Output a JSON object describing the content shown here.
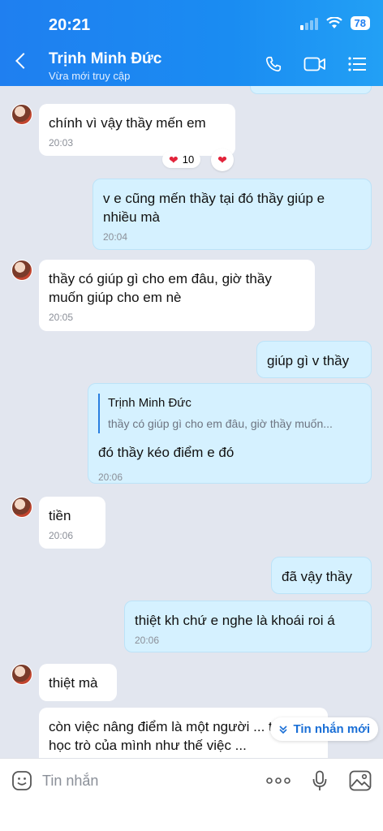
{
  "status_bar": {
    "time": "20:21",
    "battery": "78"
  },
  "header": {
    "contact_name": "Trịnh Minh Đức",
    "contact_status": "Vừa mới truy cập"
  },
  "messages": [
    {
      "text": "chính vì vậy thầy mến em",
      "time": "20:03",
      "reaction_count": "10"
    },
    {
      "text": "v e cũng mến thầy tại đó thầy giúp e nhiều mà",
      "time": "20:04"
    },
    {
      "text": "thầy có giúp gì cho em đâu, giờ thầy muốn giúp cho em nè",
      "time": "20:05"
    },
    {
      "text": "giúp gì v thầy"
    },
    {
      "quote_name": "Trịnh Minh Đức",
      "quote_text": "thầy có giúp gì cho em đâu, giờ thầy muốn...",
      "text": "đó thầy kéo điểm e đó",
      "time": "20:06"
    },
    {
      "text": "tiền",
      "time": "20:06"
    },
    {
      "text": "đã vậy thầy"
    },
    {
      "text": "thiệt kh chứ e nghe là khoái roi á",
      "time": "20:06"
    },
    {
      "text": "thiệt mà"
    },
    {
      "text": "còn việc nâng điểm là một người ... thầy học trò của mình như thế việc ..."
    }
  ],
  "new_messages_label": "Tin nhắn mới",
  "composer": {
    "placeholder": "Tin nhắn"
  },
  "colors": {
    "header": "#1f7ff0",
    "outgoing_bubble": "#d5f1ff",
    "incoming_bubble": "#ffffff",
    "background": "#e2e6ef"
  }
}
